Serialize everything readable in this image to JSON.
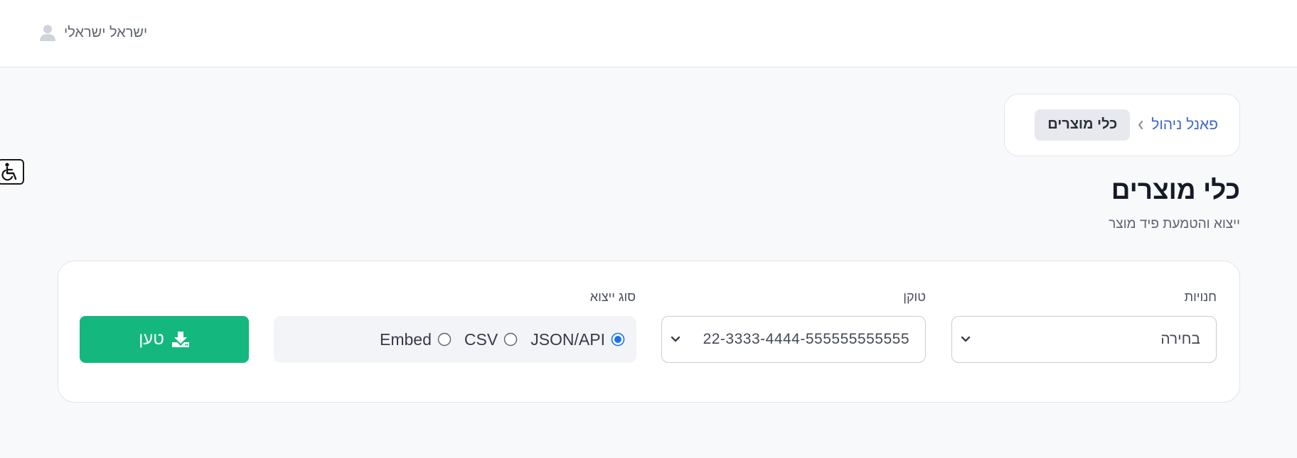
{
  "header": {
    "user_name": "ישראל ישראלי",
    "icon": "user-icon"
  },
  "accessibility": {
    "icon": "wheelchair-icon"
  },
  "breadcrumb": {
    "parent": "פאנל ניהול",
    "current": "כלי מוצרים",
    "separator_icon": "chevron-left-icon"
  },
  "page": {
    "title": "כלי מוצרים",
    "subtitle": "ייצוא והטמעת פיד מוצר"
  },
  "form": {
    "stores": {
      "label": "חנויות",
      "value": "בחירה"
    },
    "token": {
      "label": "טוקן",
      "value": "22-3333-4444-555555555555"
    },
    "export_type": {
      "label": "סוג ייצוא",
      "selected": "JSON/API",
      "options": [
        "JSON/API",
        "CSV",
        "Embed"
      ]
    },
    "submit": {
      "label": "טען",
      "icon": "download-icon"
    }
  },
  "colors": {
    "accent_green": "#14b87f",
    "link_blue": "#3f68c9",
    "radio_blue": "#1a73e8"
  }
}
